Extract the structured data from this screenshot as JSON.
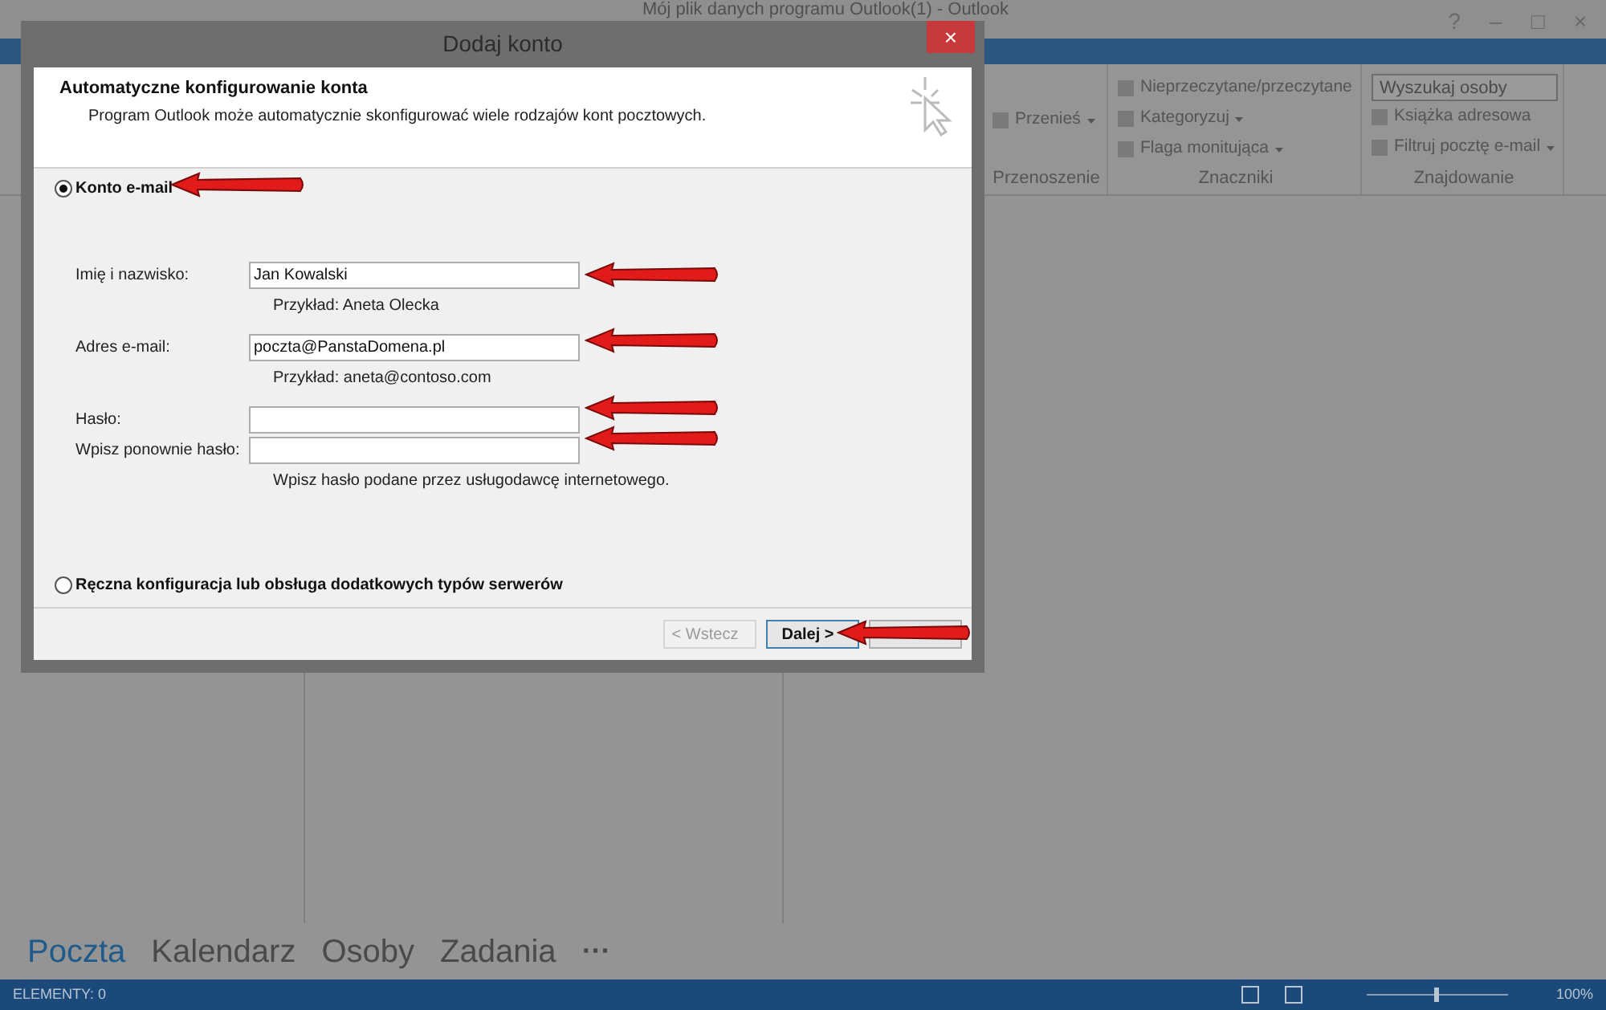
{
  "app": {
    "title": "Mój plik danych programu Outlook(1) - Outlook",
    "window_controls": [
      "?",
      "–",
      "□",
      "×"
    ],
    "ribbon_groups": [
      {
        "label": "Przenoszenie",
        "items": [
          {
            "kind": "button",
            "label": "Przenieś",
            "dropdown": true
          }
        ]
      },
      {
        "label": "Znaczniki",
        "items": [
          {
            "kind": "button",
            "label": "Nieprzeczytane/przeczytane",
            "dropdown": false
          },
          {
            "kind": "button",
            "label": "Kategoryzuj",
            "dropdown": true
          },
          {
            "kind": "button",
            "label": "Flaga monitująca",
            "dropdown": true
          }
        ]
      },
      {
        "label": "Znajdowanie",
        "items": [
          {
            "kind": "search",
            "placeholder": "Wyszukaj osoby"
          },
          {
            "kind": "button",
            "label": "Książka adresowa",
            "dropdown": false
          },
          {
            "kind": "button",
            "label": "Filtruj pocztę e-mail",
            "dropdown": true
          }
        ]
      }
    ],
    "nav": [
      {
        "label": "Poczta",
        "selected": true
      },
      {
        "label": "Kalendarz",
        "selected": false
      },
      {
        "label": "Osoby",
        "selected": false
      },
      {
        "label": "Zadania",
        "selected": false
      }
    ],
    "nav_more": "···",
    "status_bar": {
      "count": "ELEMENTY: 0",
      "zoom": "100%",
      "level": 0.5
    }
  },
  "dialog": {
    "title": "Dodaj konto",
    "close": "×",
    "header": {
      "title": "Automatyczne konfigurowanie konta",
      "subtitle": "Program Outlook może automatycznie skonfigurować wiele rodzajów kont pocztowych."
    },
    "options": [
      {
        "label": "Konto e-mail",
        "selected": true
      },
      {
        "label": "Ręczna konfiguracja lub obsługa dodatkowych typów serwerów",
        "selected": false
      }
    ],
    "fields": [
      {
        "label": "Imię i nazwisko:",
        "value": "Jan Kowalski",
        "hint": "Przykład: Aneta Olecka"
      },
      {
        "label": "Adres e-mail:",
        "value": "poczta@PanstaDomena.pl",
        "hint": "Przykład: aneta@contoso.com"
      },
      {
        "label": "Hasło:"
      },
      {
        "label": "Wpisz ponownie hasło:",
        "hint": "Wpisz hasło podane przez usługodawcę internetowego."
      }
    ],
    "buttons": [
      {
        "label": "< Wstecz",
        "disabled": true,
        "default": false
      },
      {
        "label": "Dalej >",
        "disabled": false,
        "default": true
      }
    ],
    "covered_button": true
  }
}
